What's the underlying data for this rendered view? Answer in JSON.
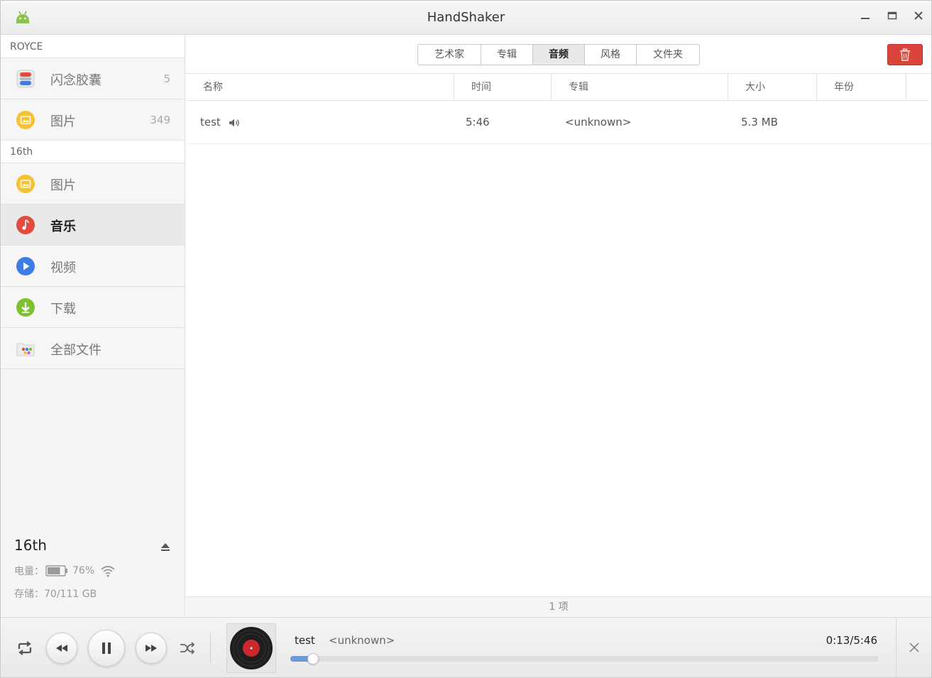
{
  "window": {
    "title": "HandShaker"
  },
  "sidebar": {
    "sections": [
      {
        "header": "ROYCE",
        "items": [
          {
            "label": "闪念胶囊",
            "count": "5",
            "icon": "capsule-icon"
          },
          {
            "label": "图片",
            "count": "349",
            "icon": "image-icon"
          }
        ]
      },
      {
        "header": "16th",
        "items": [
          {
            "label": "图片",
            "icon": "image-icon"
          },
          {
            "label": "音乐",
            "icon": "music-icon",
            "active": true
          },
          {
            "label": "视频",
            "icon": "video-icon"
          },
          {
            "label": "下载",
            "icon": "download-icon"
          },
          {
            "label": "全部文件",
            "icon": "folder-icon"
          }
        ]
      }
    ],
    "device": {
      "name": "16th",
      "battery_label": "电量：",
      "battery_value": "76%",
      "battery_level": 0.76,
      "storage_label": "存储：",
      "storage_value": "70/111 GB"
    }
  },
  "main": {
    "tabs": [
      {
        "label": "艺术家"
      },
      {
        "label": "专辑"
      },
      {
        "label": "音频",
        "active": true
      },
      {
        "label": "风格"
      },
      {
        "label": "文件夹"
      }
    ],
    "columns": [
      "名称",
      "时间",
      "专辑",
      "大小",
      "年份"
    ],
    "rows": [
      {
        "name": "test",
        "time": "5:46",
        "album": "<unknown>",
        "size": "5.3 MB",
        "year": "",
        "playing": true
      }
    ],
    "status": "1 项"
  },
  "player": {
    "title": "test",
    "artist": "<unknown>",
    "time": "0:13/5:46",
    "progress": 0.038
  },
  "colors": {
    "accent": "#6a9ad8",
    "danger": "#d9443b",
    "music": "#e34b3f",
    "video": "#3d7be6",
    "download": "#7cc12f",
    "image": "#f5c232"
  }
}
